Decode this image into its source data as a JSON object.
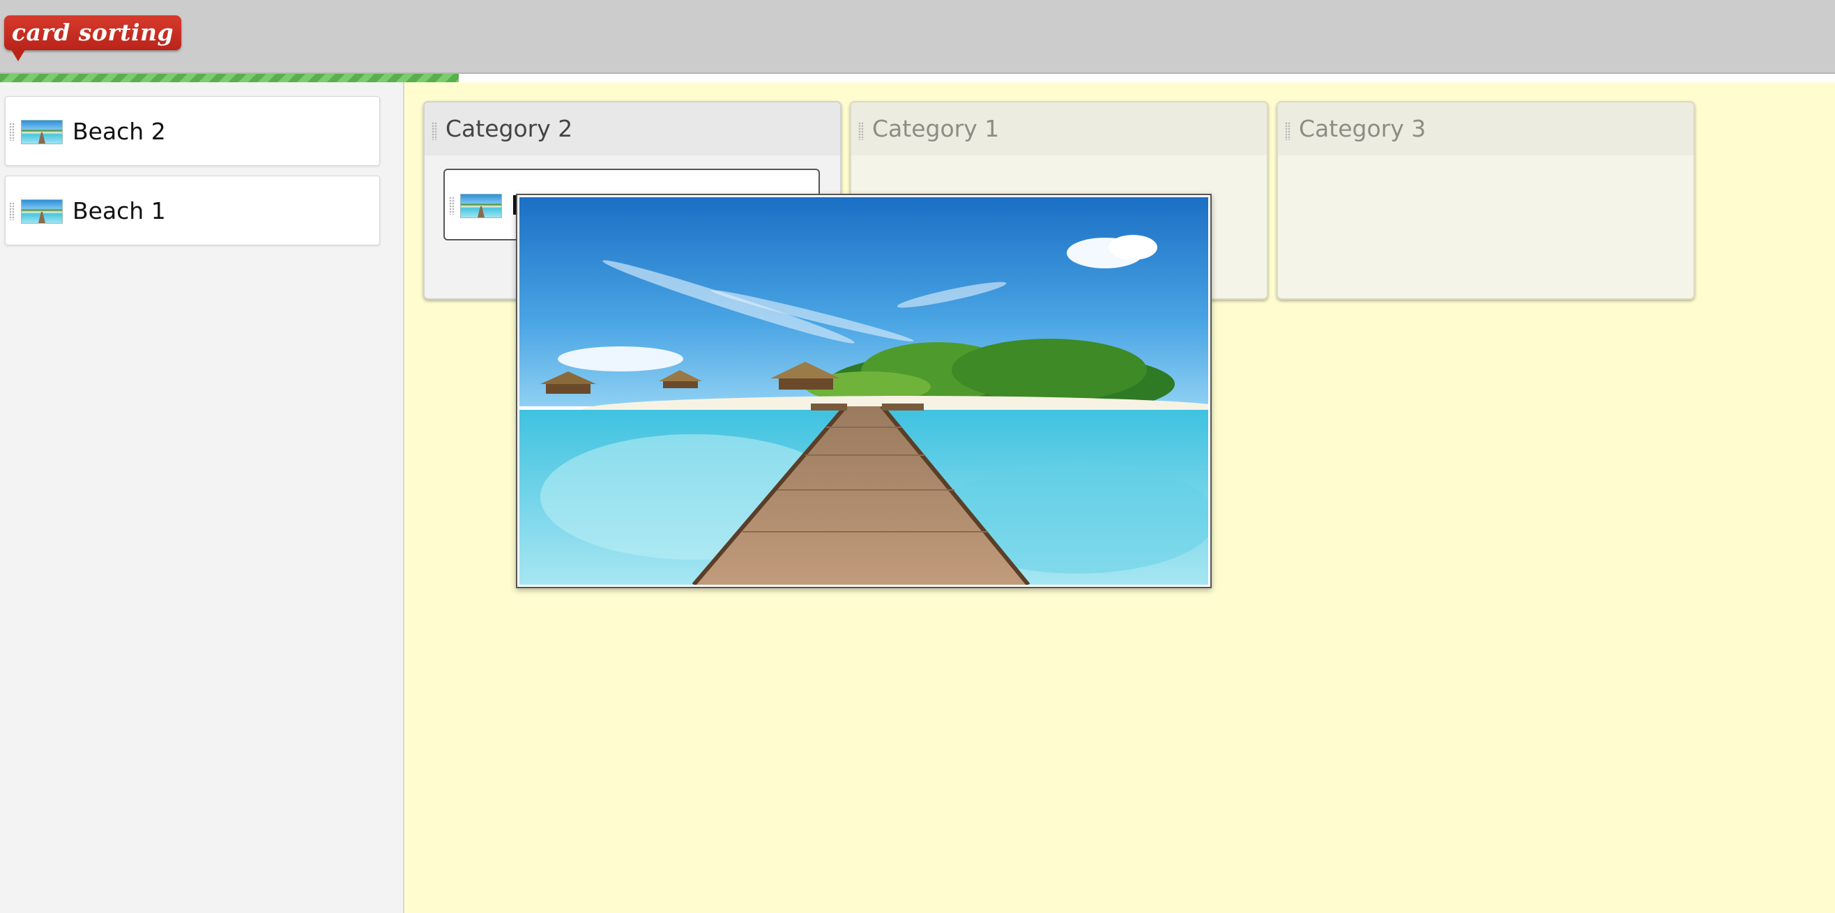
{
  "app": {
    "logo_text": "card sorting",
    "progress_fraction": 0.25,
    "colors": {
      "logo": "#c62d22",
      "progress": "#5aae4e",
      "workspace": "#fffdd0"
    }
  },
  "unsorted_cards": [
    {
      "label": "Beach 2",
      "icon": "beach-thumbnail"
    },
    {
      "label": "Beach 1",
      "icon": "beach-thumbnail"
    }
  ],
  "categories": [
    {
      "title": "Category 2",
      "state": "active"
    },
    {
      "title": "Category 1",
      "state": "inactive"
    },
    {
      "title": "Category 3",
      "state": "inactive"
    }
  ],
  "popup": {
    "image": "tropical-beach-pier"
  }
}
